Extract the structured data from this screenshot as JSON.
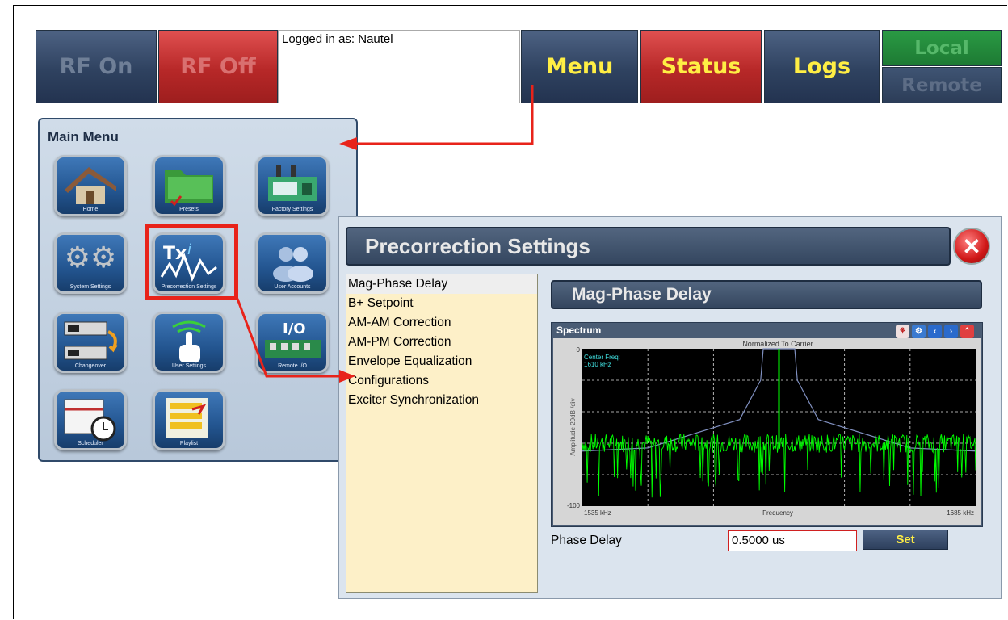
{
  "top_bar": {
    "rf_on": "RF On",
    "rf_off": "RF Off",
    "logged_in": "Logged in as: Nautel",
    "menu": "Menu",
    "status": "Status",
    "logs": "Logs",
    "local": "Local",
    "remote": "Remote"
  },
  "main_menu": {
    "title": "Main Menu",
    "items": [
      {
        "label": "Home",
        "icon": "house-icon"
      },
      {
        "label": "Presets",
        "icon": "folder-icon"
      },
      {
        "label": "Factory Settings",
        "icon": "factory-icon"
      },
      {
        "label": "System Settings",
        "icon": "gears-icon"
      },
      {
        "label": "Precorrection Settings",
        "icon": "txi-waveform-icon"
      },
      {
        "label": "User Accounts",
        "icon": "users-icon"
      },
      {
        "label": "Changeover",
        "icon": "changeover-icon"
      },
      {
        "label": "User Settings",
        "icon": "touch-hand-icon"
      },
      {
        "label": "Remote I/O",
        "icon": "io-board-icon"
      },
      {
        "label": "Scheduler",
        "icon": "calendar-clock-icon"
      },
      {
        "label": "Playlist",
        "icon": "playlist-icon"
      }
    ]
  },
  "precorrection": {
    "title": "Precorrection Settings",
    "list": [
      "Mag-Phase Delay",
      "B+ Setpoint",
      "AM-AM Correction",
      "AM-PM Correction",
      "Envelope Equalization",
      "Configurations",
      "Exciter Synchronization"
    ],
    "selected": "Mag-Phase Delay",
    "section_title": "Mag-Phase Delay",
    "phase_delay_label": "Phase Delay",
    "phase_delay_value": "0.5000 us",
    "set_label": "Set"
  },
  "chart_data": {
    "type": "line",
    "panel_title": "Spectrum",
    "title": "Normalized To Carrier",
    "xlabel": "Frequency",
    "ylabel": "Amplitude 20dB /div",
    "x_min_label": "1535 kHz",
    "x_max_label": "1685 kHz",
    "y_top_label": "0",
    "y_bottom_label": "-100",
    "center_freq_label": "Center Freq:",
    "center_freq_value": "1610 kHz",
    "xlim": [
      1535,
      1685
    ],
    "ylim": [
      -100,
      0
    ],
    "grid": true,
    "series": [
      {
        "name": "",
        "color": "#00ff00",
        "type": "noise-spectrum",
        "noise_floor_db": -60,
        "carrier_freq_khz": 1610
      },
      {
        "name": "",
        "color": "#8090c0",
        "type": "mask",
        "points": [
          [
            1535,
            -65
          ],
          [
            1560,
            -63
          ],
          [
            1595,
            -45
          ],
          [
            1603,
            -20
          ],
          [
            1604,
            0
          ],
          [
            1616,
            0
          ],
          [
            1617,
            -20
          ],
          [
            1625,
            -45
          ],
          [
            1660,
            -63
          ],
          [
            1685,
            -65
          ]
        ]
      }
    ]
  },
  "colors": {
    "accent_yellow": "#ffee44",
    "arrow_red": "#e8231a",
    "list_bg": "#fdf0c8",
    "spectrum_green": "#00ff00"
  }
}
